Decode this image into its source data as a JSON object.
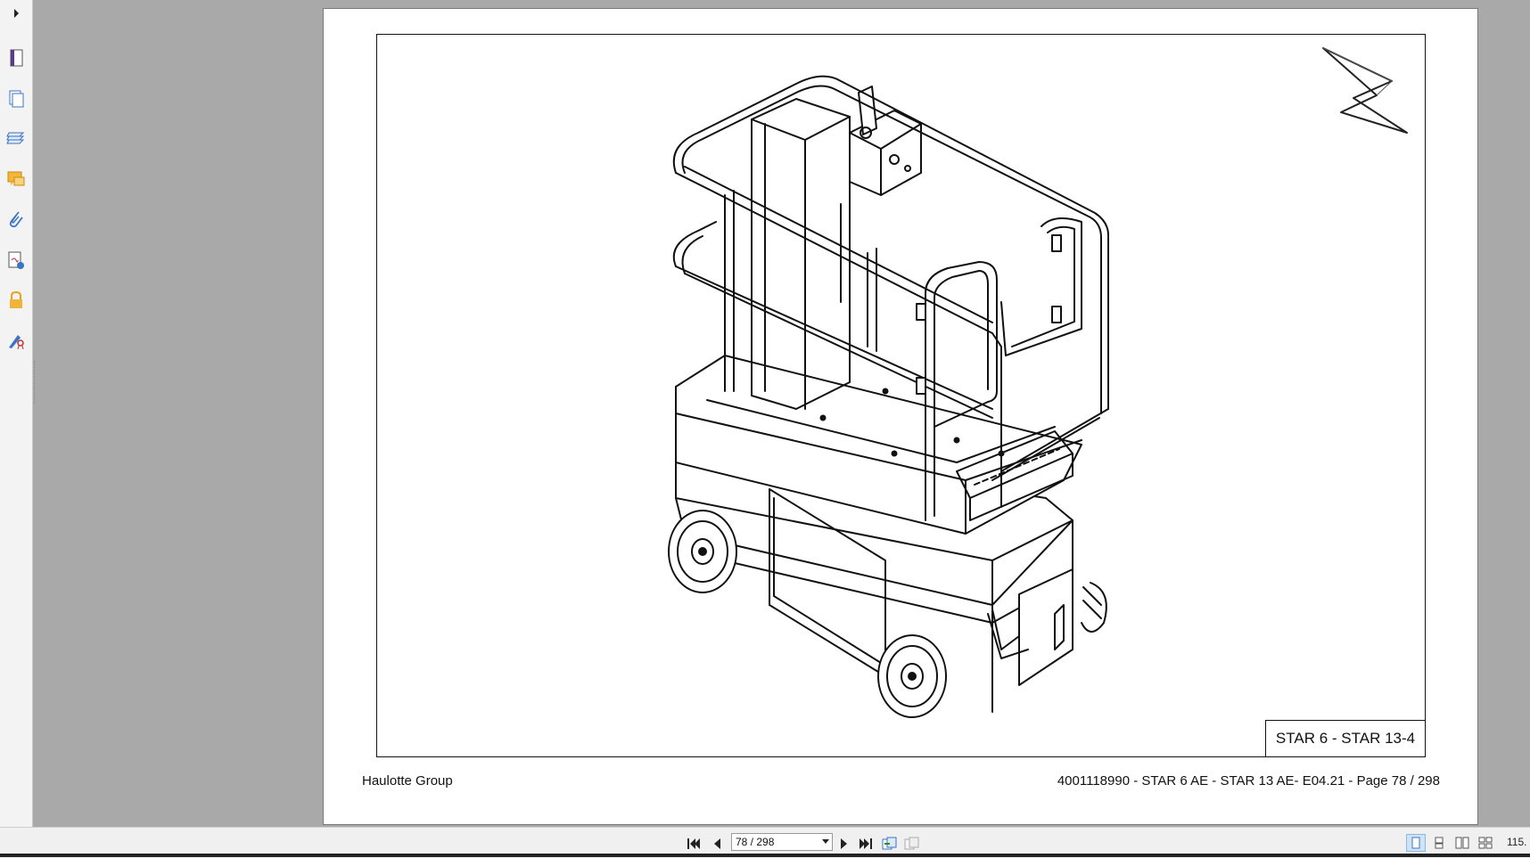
{
  "document": {
    "frame_title": "STAR 6 - STAR 13-4",
    "footer_left": "Haulotte Group",
    "footer_right": "4001118990 - STAR 6 AE - STAR 13 AE- E04.21 - Page 78 / 298"
  },
  "sidebar": {
    "tools": [
      {
        "icon": "page-thumbnail-icon"
      },
      {
        "icon": "pages-icon"
      },
      {
        "icon": "layers-icon"
      },
      {
        "icon": "comments-icon"
      },
      {
        "icon": "attachments-icon"
      },
      {
        "icon": "signatures-icon"
      },
      {
        "icon": "security-lock-icon"
      },
      {
        "icon": "certificate-icon"
      }
    ]
  },
  "toolbar": {
    "page_field": "78 / 298",
    "zoom": "115."
  },
  "colors": {
    "viewer_bg": "#a9a9a9",
    "sidebar_bg": "#f3f3f3",
    "accent_blue": "#3a74c4",
    "icon_orange": "#e8a020"
  }
}
